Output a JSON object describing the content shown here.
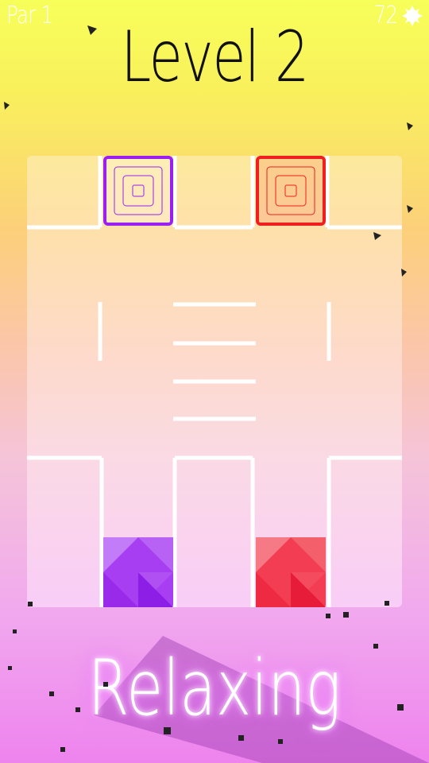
{
  "hud": {
    "par_label": "Par 1",
    "coins": "72",
    "coin_icon": "gear-coin-icon"
  },
  "level": {
    "title": "Level 2"
  },
  "board": {
    "goals": [
      {
        "color": "#9b1ff0",
        "name": "purple-goal"
      },
      {
        "color": "#f01e1e",
        "name": "red-goal"
      }
    ],
    "blocks": [
      {
        "color": "#b040f0",
        "name": "purple-block"
      },
      {
        "color": "#f03c50",
        "name": "red-block"
      }
    ]
  },
  "tagline": "Relaxing",
  "colors": {
    "bg_top": "#f7ff5a",
    "bg_bottom": "#ee83ee",
    "wall": "#ffffff"
  }
}
